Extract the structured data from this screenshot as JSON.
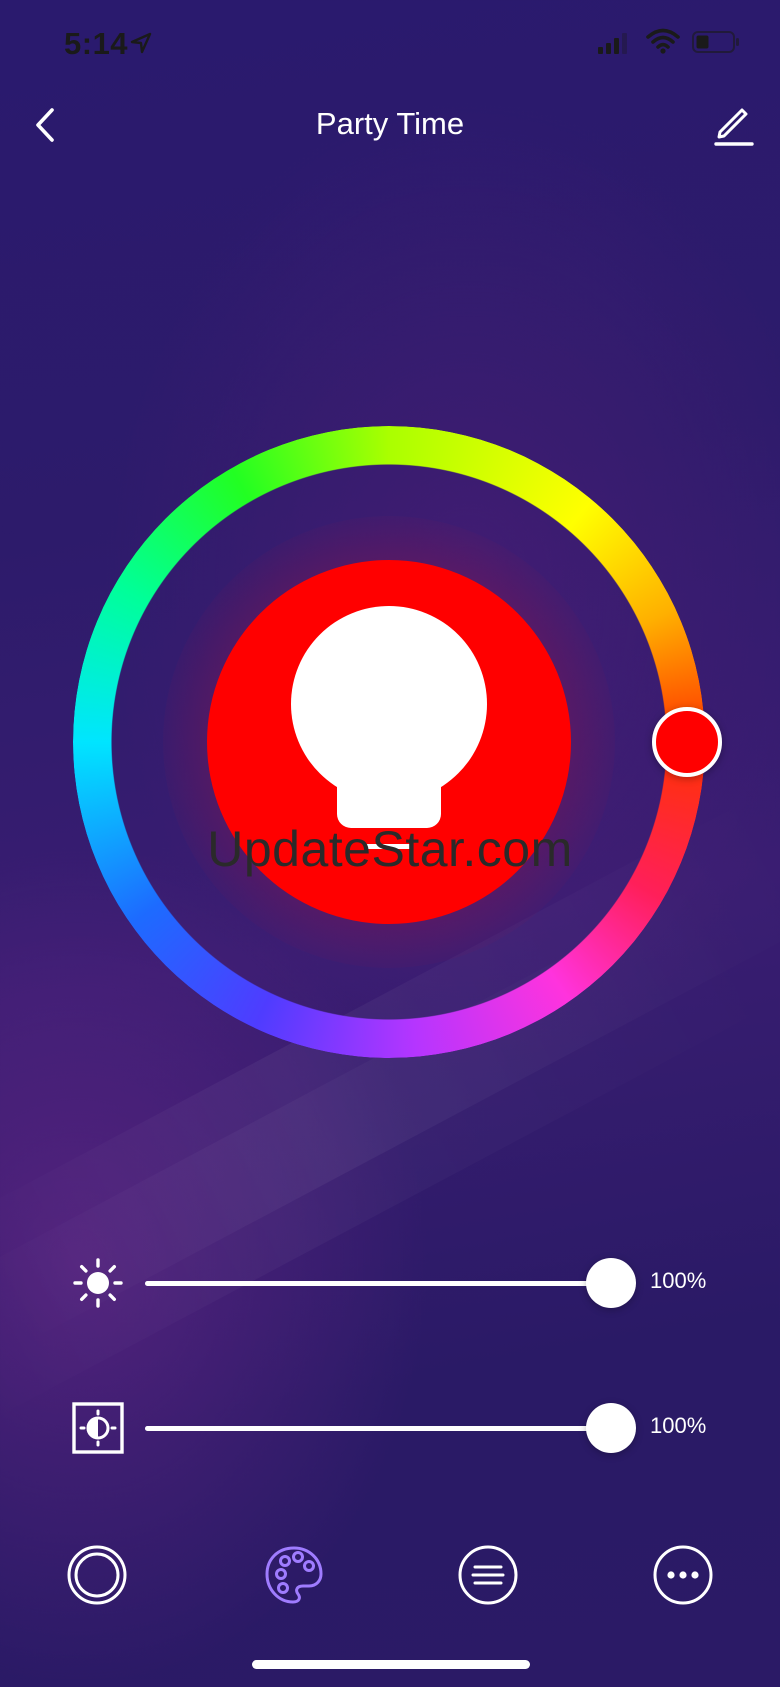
{
  "status_bar": {
    "time": "5:14",
    "icons": [
      "location-arrow-icon",
      "signal-icon",
      "wifi-icon",
      "battery-icon"
    ]
  },
  "header": {
    "title": "Party Time",
    "back_icon": "chevron-left-icon",
    "edit_icon": "pencil-icon"
  },
  "color_wheel": {
    "selected_color": "#ff0000",
    "selected_hue_deg": 0,
    "center_icon": "light-bulb-icon"
  },
  "watermark": {
    "text": "UpdateStar.com"
  },
  "brightness": {
    "icon": "sun-icon",
    "value": 100,
    "value_label": "100%"
  },
  "contrast": {
    "icon": "contrast-icon",
    "value": 100,
    "value_label": "100%"
  },
  "tabs": [
    {
      "icon": "circle-icon",
      "active": false
    },
    {
      "icon": "palette-icon",
      "active": true
    },
    {
      "icon": "list-icon",
      "active": false
    },
    {
      "icon": "more-icon",
      "active": false
    }
  ],
  "colors": {
    "accent_purple": "#9f7cff",
    "bulb_red": "#ff0000"
  }
}
